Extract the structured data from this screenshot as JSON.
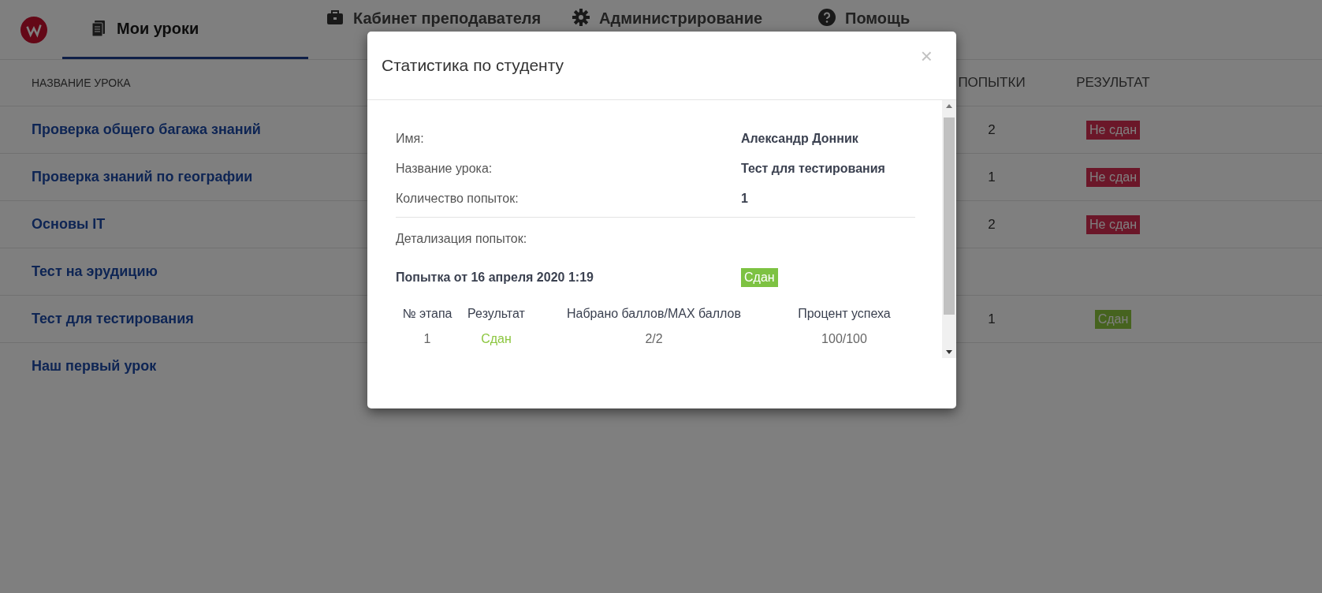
{
  "nav": {
    "tabs": [
      {
        "label": "Мои уроки",
        "selected": true
      },
      {
        "label": "Кабинет преподавателя",
        "selected": false
      },
      {
        "label": "Администрирование",
        "selected": false
      },
      {
        "label": "Помощь",
        "selected": false
      }
    ]
  },
  "table": {
    "columns": [
      "НАЗВАНИЕ УРОКА",
      "ПОПЫТКИ",
      "РЕЗУЛЬТАТ"
    ],
    "rows": [
      {
        "lesson": "Проверка общего багажа знаний",
        "attempts": "2",
        "result": {
          "label": "Не сдан",
          "passed": false
        }
      },
      {
        "lesson": "Проверка знаний по географии",
        "attempts": "1",
        "result": {
          "label": "Не сдан",
          "passed": false
        }
      },
      {
        "lesson": "Основы IT",
        "attempts": "2",
        "result": {
          "label": "Не сдан",
          "passed": false
        }
      },
      {
        "lesson": "Тест на эрудицию"
      },
      {
        "lesson": "Тест для тестирования",
        "attempts": "1",
        "result": {
          "label": "Сдан",
          "passed": true
        }
      },
      {
        "lesson": "Наш первый урок"
      }
    ]
  },
  "modal": {
    "title": "Статистика по студенту",
    "close": "×",
    "fields": [
      {
        "label": "Имя:",
        "value": "Александр Донник"
      },
      {
        "label": "Название урока:",
        "value": "Тест для тестирования"
      },
      {
        "label": "Количество попыток:",
        "value": "1"
      }
    ],
    "details_label": "Детализация попыток:",
    "attempt": {
      "title": "Попытка от 16 апреля 2020 1:19",
      "result": {
        "label": "Сдан",
        "passed": true
      }
    },
    "stages": {
      "columns": [
        "№ этапа",
        "Результат",
        "Набрано баллов/MAX баллов",
        "Процент успеха"
      ],
      "rows": [
        {
          "stage": "1",
          "result": "Сдан",
          "passed": true,
          "score": "2/2",
          "percent": "100/100"
        }
      ]
    }
  }
}
